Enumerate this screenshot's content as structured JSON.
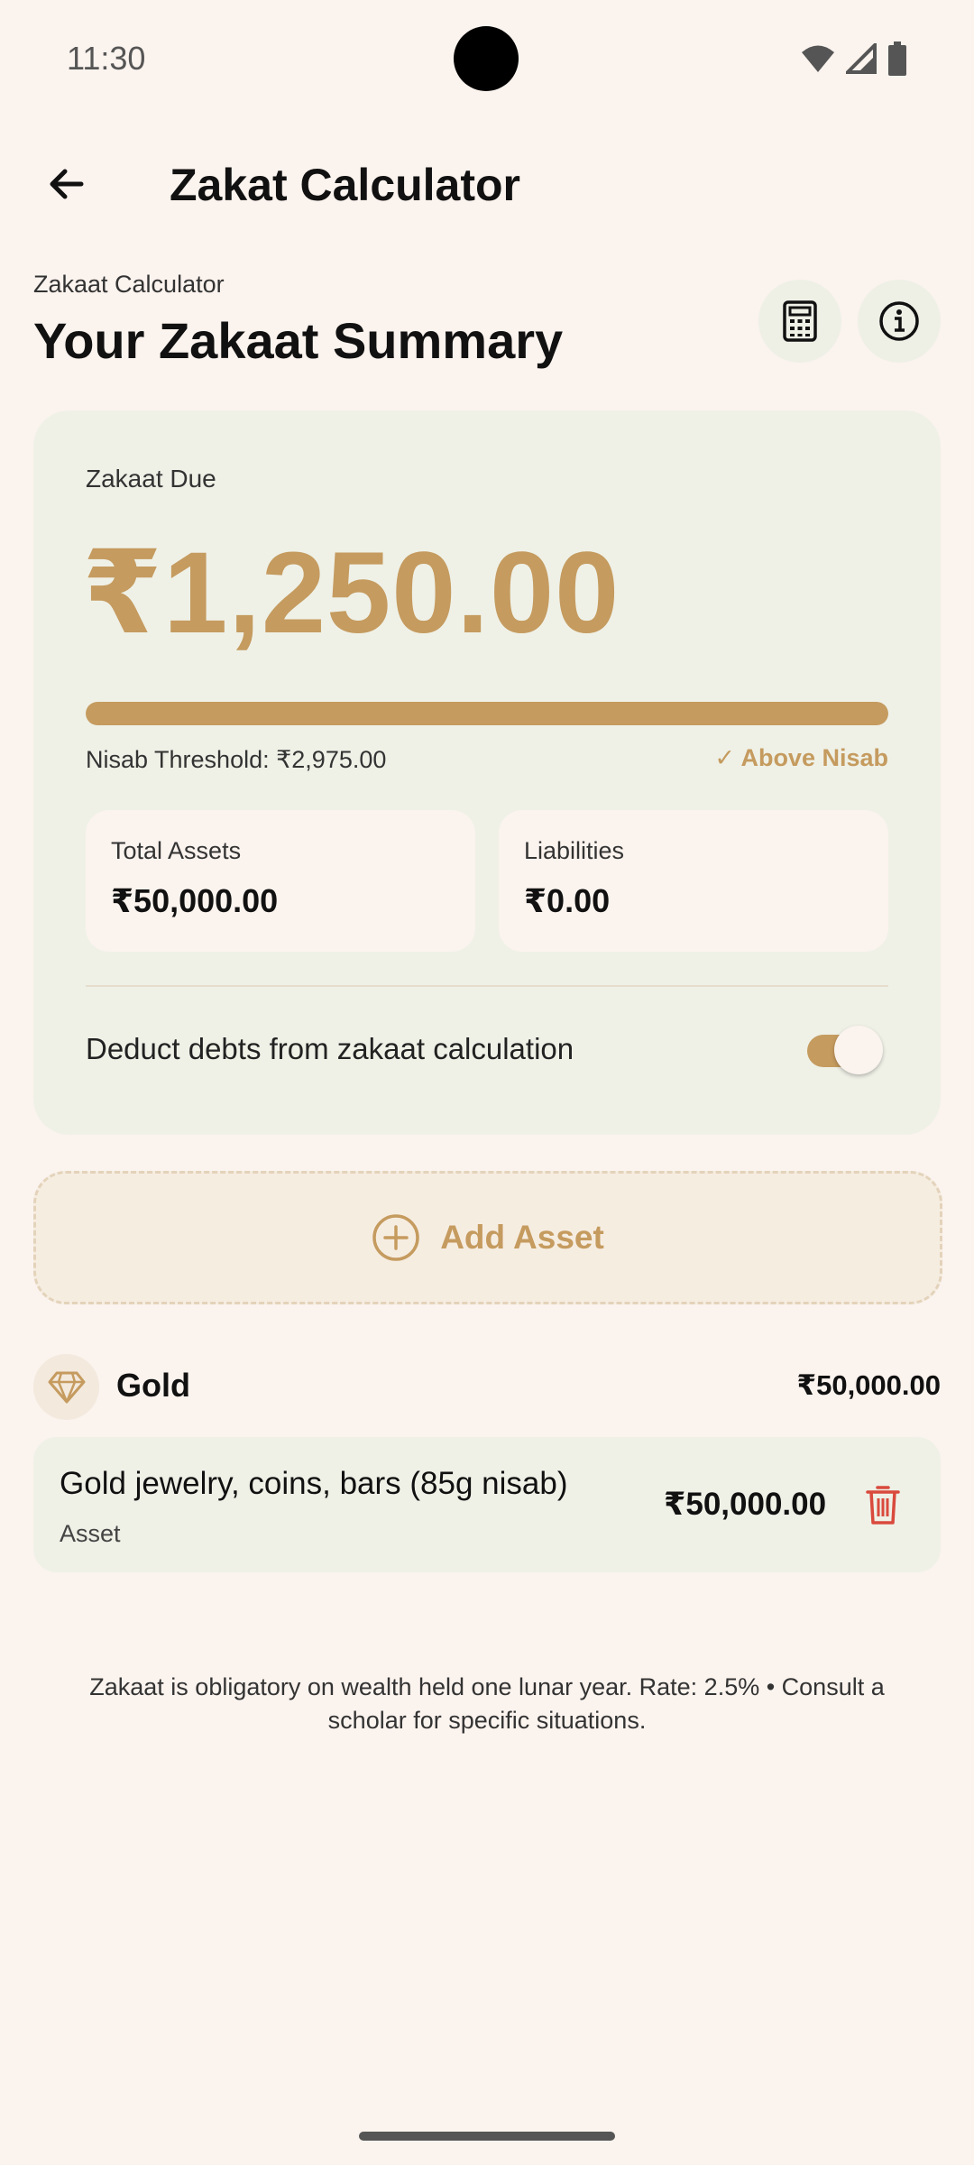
{
  "status_bar": {
    "time": "11:30"
  },
  "app_bar": {
    "title": "Zakat Calculator"
  },
  "header": {
    "sub_label": "Zakaat Calculator",
    "title": "Your Zakaat Summary"
  },
  "summary": {
    "due_label": "Zakaat Due",
    "due_amount": "₹1,250.00",
    "progress_fraction": 1.0,
    "nisab_label": "Nisab Threshold: ₹2,975.00",
    "nisab_status": "✓ Above Nisab",
    "total_assets_label": "Total Assets",
    "total_assets_value": "₹50,000.00",
    "liabilities_label": "Liabilities",
    "liabilities_value": "₹0.00",
    "deduct_label": "Deduct debts from zakaat calculation",
    "deduct_enabled": true
  },
  "add_asset": {
    "label": "Add Asset",
    "icon": "plus-circle-icon"
  },
  "category": {
    "name": "Gold",
    "total": "₹50,000.00",
    "icon": "diamond-icon",
    "items": [
      {
        "name": "Gold jewelry, coins, bars (85g nisab)",
        "type": "Asset",
        "value": "₹50,000.00"
      }
    ]
  },
  "footnote": "Zakaat is obligatory on wealth held one lunar year. Rate: 2.5% • Consult a scholar for specific situations.",
  "colors": {
    "accent": "#C59B5F",
    "card_bg": "#EFF1E7",
    "page_bg": "#FBF3EE",
    "danger": "#D94A3D"
  }
}
